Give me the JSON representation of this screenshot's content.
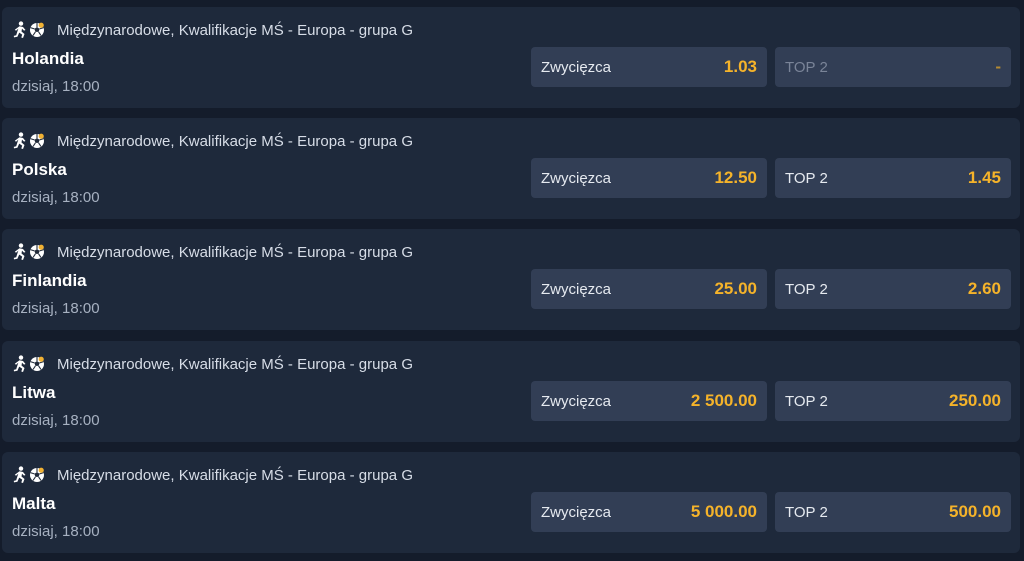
{
  "colors": {
    "background": "#141c2b",
    "card": "#1e293b",
    "odd_button": "#323e55",
    "odd_value": "#f5b32a"
  },
  "icons": [
    "player-kick-icon",
    "soccer-ball-icon"
  ],
  "events": [
    {
      "league": "Międzynarodowe, Kwalifikacje MŚ - Europa - grupa G",
      "team": "Holandia",
      "time": "dzisiaj, 18:00",
      "winner": {
        "label": "Zwycięzca",
        "value": "1.03"
      },
      "top2": {
        "label": "TOP 2",
        "value": "-",
        "disabled": true
      }
    },
    {
      "league": "Międzynarodowe, Kwalifikacje MŚ - Europa - grupa G",
      "team": "Polska",
      "time": "dzisiaj, 18:00",
      "winner": {
        "label": "Zwycięzca",
        "value": "12.50"
      },
      "top2": {
        "label": "TOP 2",
        "value": "1.45",
        "disabled": false
      }
    },
    {
      "league": "Międzynarodowe, Kwalifikacje MŚ - Europa - grupa G",
      "team": "Finlandia",
      "time": "dzisiaj, 18:00",
      "winner": {
        "label": "Zwycięzca",
        "value": "25.00"
      },
      "top2": {
        "label": "TOP 2",
        "value": "2.60",
        "disabled": false
      }
    },
    {
      "league": "Międzynarodowe, Kwalifikacje MŚ - Europa - grupa G",
      "team": "Litwa",
      "time": "dzisiaj, 18:00",
      "winner": {
        "label": "Zwycięzca",
        "value": "2 500.00"
      },
      "top2": {
        "label": "TOP 2",
        "value": "250.00",
        "disabled": false
      }
    },
    {
      "league": "Międzynarodowe, Kwalifikacje MŚ - Europa - grupa G",
      "team": "Malta",
      "time": "dzisiaj, 18:00",
      "winner": {
        "label": "Zwycięzca",
        "value": "5 000.00"
      },
      "top2": {
        "label": "TOP 2",
        "value": "500.00",
        "disabled": false
      }
    }
  ]
}
